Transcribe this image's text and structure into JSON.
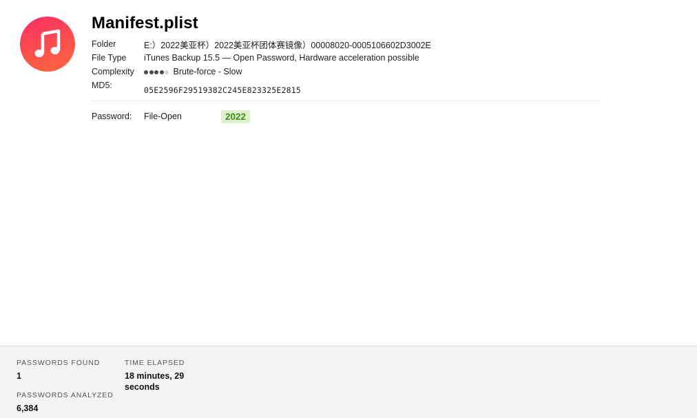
{
  "file": {
    "icon": "music-note-icon",
    "icon_colors": [
      "#fb2d63",
      "#fb6a3c"
    ],
    "title": "Manifest.plist"
  },
  "info": {
    "folder_label": "Folder",
    "folder_value": "E:）2022美亚杯）2022美亚杯团体赛镜像）00008020-0005106602D3002E",
    "filetype_label": "File Type",
    "filetype_value": "iTunes Backup 15.5 — Open Password, Hardware acceleration possible",
    "complexity_label": "Complexity",
    "complexity_level": 4,
    "complexity_max": 5,
    "complexity_value": "Brute-force - Slow",
    "md5_label": "MD5:",
    "md5_value": "05E2596F29519382C245E823325E2815"
  },
  "password": {
    "label": "Password:",
    "kind": "File-Open",
    "value": "2022",
    "value_color": "#3f8f12"
  },
  "stats": {
    "found_label": "PASSWORDS FOUND",
    "found_value": "1",
    "analyzed_label": "PASSWORDS ANALYZED",
    "analyzed_value": "6,384",
    "elapsed_label": "TIME ELAPSED",
    "elapsed_value": "18 minutes, 29 seconds"
  }
}
